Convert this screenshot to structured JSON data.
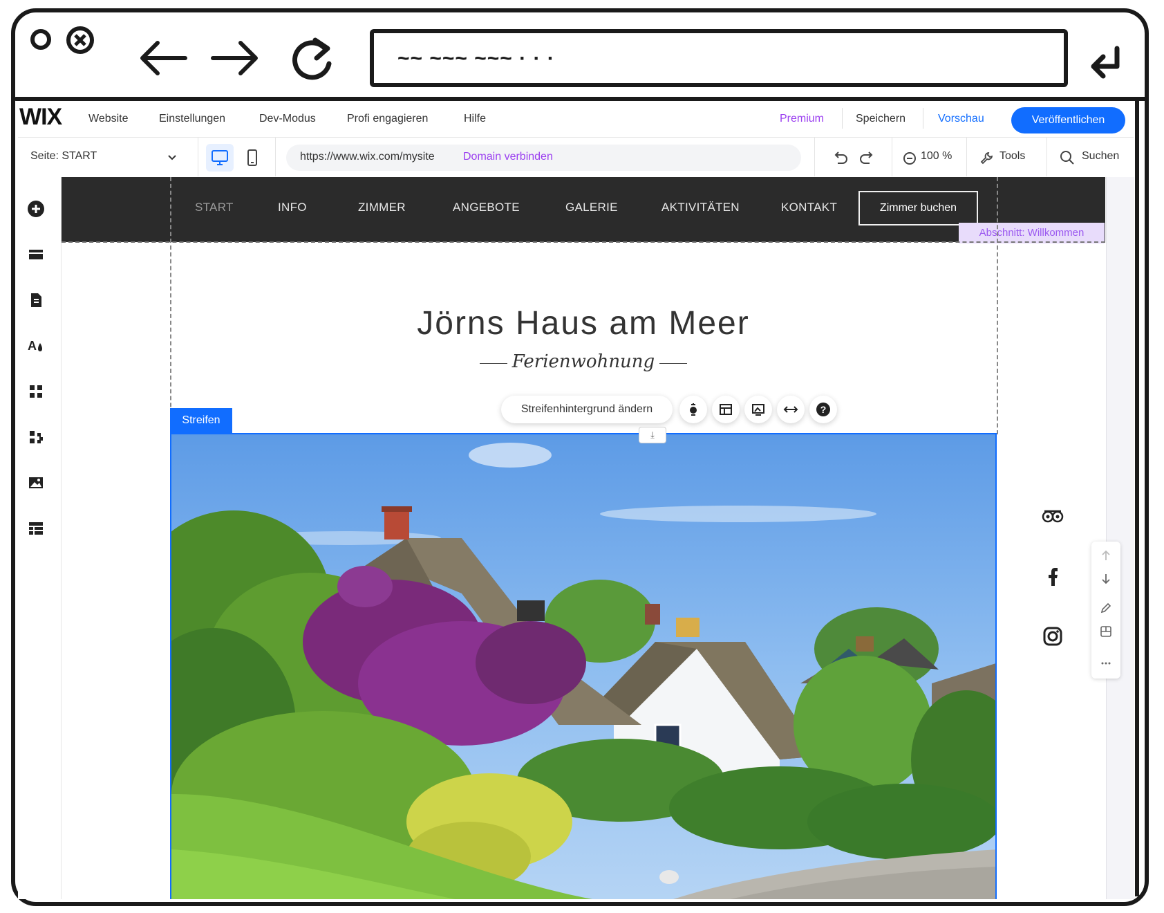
{
  "browser": {
    "url_scribble": "~~ ~~~ ~~~ · · ·",
    "back_icon": "arrow-left-icon",
    "forward_icon": "arrow-right-icon",
    "reload_icon": "reload-icon",
    "enter_icon": "return-icon"
  },
  "topbar": {
    "logo": "WIX",
    "menu": [
      "Website",
      "Einstellungen",
      "Dev-Modus",
      "Profi engagieren",
      "Hilfe"
    ],
    "premium": "Premium",
    "save": "Speichern",
    "preview": "Vorschau",
    "publish": "Veröffentlichen"
  },
  "toolbar": {
    "page_select": "Seite: START",
    "address_url": "https://www.wix.com/mysite",
    "domain_link": "Domain verbinden",
    "zoom": "100 %",
    "tools": "Tools",
    "search": "Suchen"
  },
  "site": {
    "nav": [
      "START",
      "INFO",
      "ZIMMER",
      "ANGEBOTE",
      "GALERIE",
      "AKTIVITÄTEN",
      "KONTAKT"
    ],
    "book_button": "Zimmer buchen",
    "section_label": "Abschnitt: Willkommen",
    "title": "Jörns Haus am Meer",
    "subtitle": "Ferienwohnung"
  },
  "strip": {
    "label": "Streifen",
    "change_background": "Streifenhintergrund ändern",
    "tool_icons": [
      "animation-icon",
      "layout-icon",
      "background-icon",
      "stretch-icon",
      "help-icon"
    ]
  },
  "colors": {
    "accent": "#116dff",
    "premium": "#9b3ff0",
    "header_bg": "#2b2b2b",
    "section_label_bg": "#e8dcfb"
  }
}
